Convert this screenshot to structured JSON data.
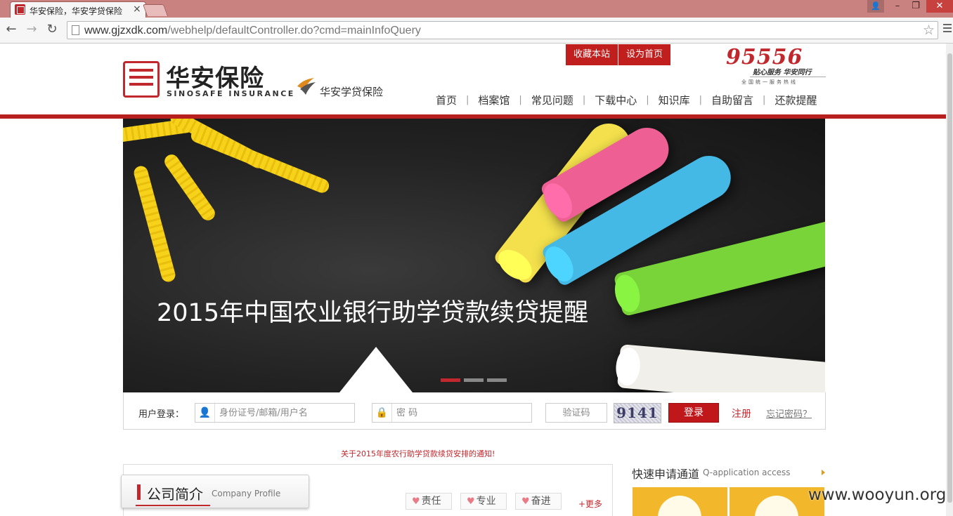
{
  "browser": {
    "tab_title": "华安保险，华安学贷保险",
    "url_host": "www.gjzxdk.com",
    "url_path": "/webhelp/defaultController.do?cmd=mainInfoQuery"
  },
  "header": {
    "top_links": [
      "收藏本站",
      "设为首页"
    ],
    "logo_cn": "华安保险",
    "logo_en": "SINOSAFE INSURANCE",
    "sub_logo": "华安学贷保险",
    "hotline_number": "95556",
    "hotline_slogan": "贴心服务  华安同行",
    "hotline_sub": "全国统一服务热线",
    "nav": [
      "首页",
      "档案馆",
      "常见问题",
      "下载中心",
      "知识库",
      "自助留言",
      "还款提醒"
    ]
  },
  "banner": {
    "caption": "2015年中国农业银行助学贷款续贷提醒",
    "slides": 3,
    "active_slide": 1
  },
  "login": {
    "label": "用户登录：",
    "username_placeholder": "身份证号/邮箱/用户名",
    "password_placeholder": "密 码",
    "captcha_placeholder": "验证码",
    "captcha_code": "9141",
    "login_button": "登录",
    "register_link": "注册",
    "forgot_link": "忘记密码？"
  },
  "notice": "关于2015年度农行助学贷款续贷安排的通知!",
  "profile": {
    "title_cn": "公司简介",
    "title_en": "Company Profile",
    "tags": [
      "责任",
      "专业",
      "奋进"
    ],
    "more_link": "+更多"
  },
  "quick": {
    "title": "快速申请通道",
    "subtitle": "Q-application access"
  },
  "watermark": "www.wooyun.org",
  "colors": {
    "brand_red": "#c0282e",
    "nav_red": "#c11f1d",
    "quick_yellow": "#f2b72a"
  }
}
